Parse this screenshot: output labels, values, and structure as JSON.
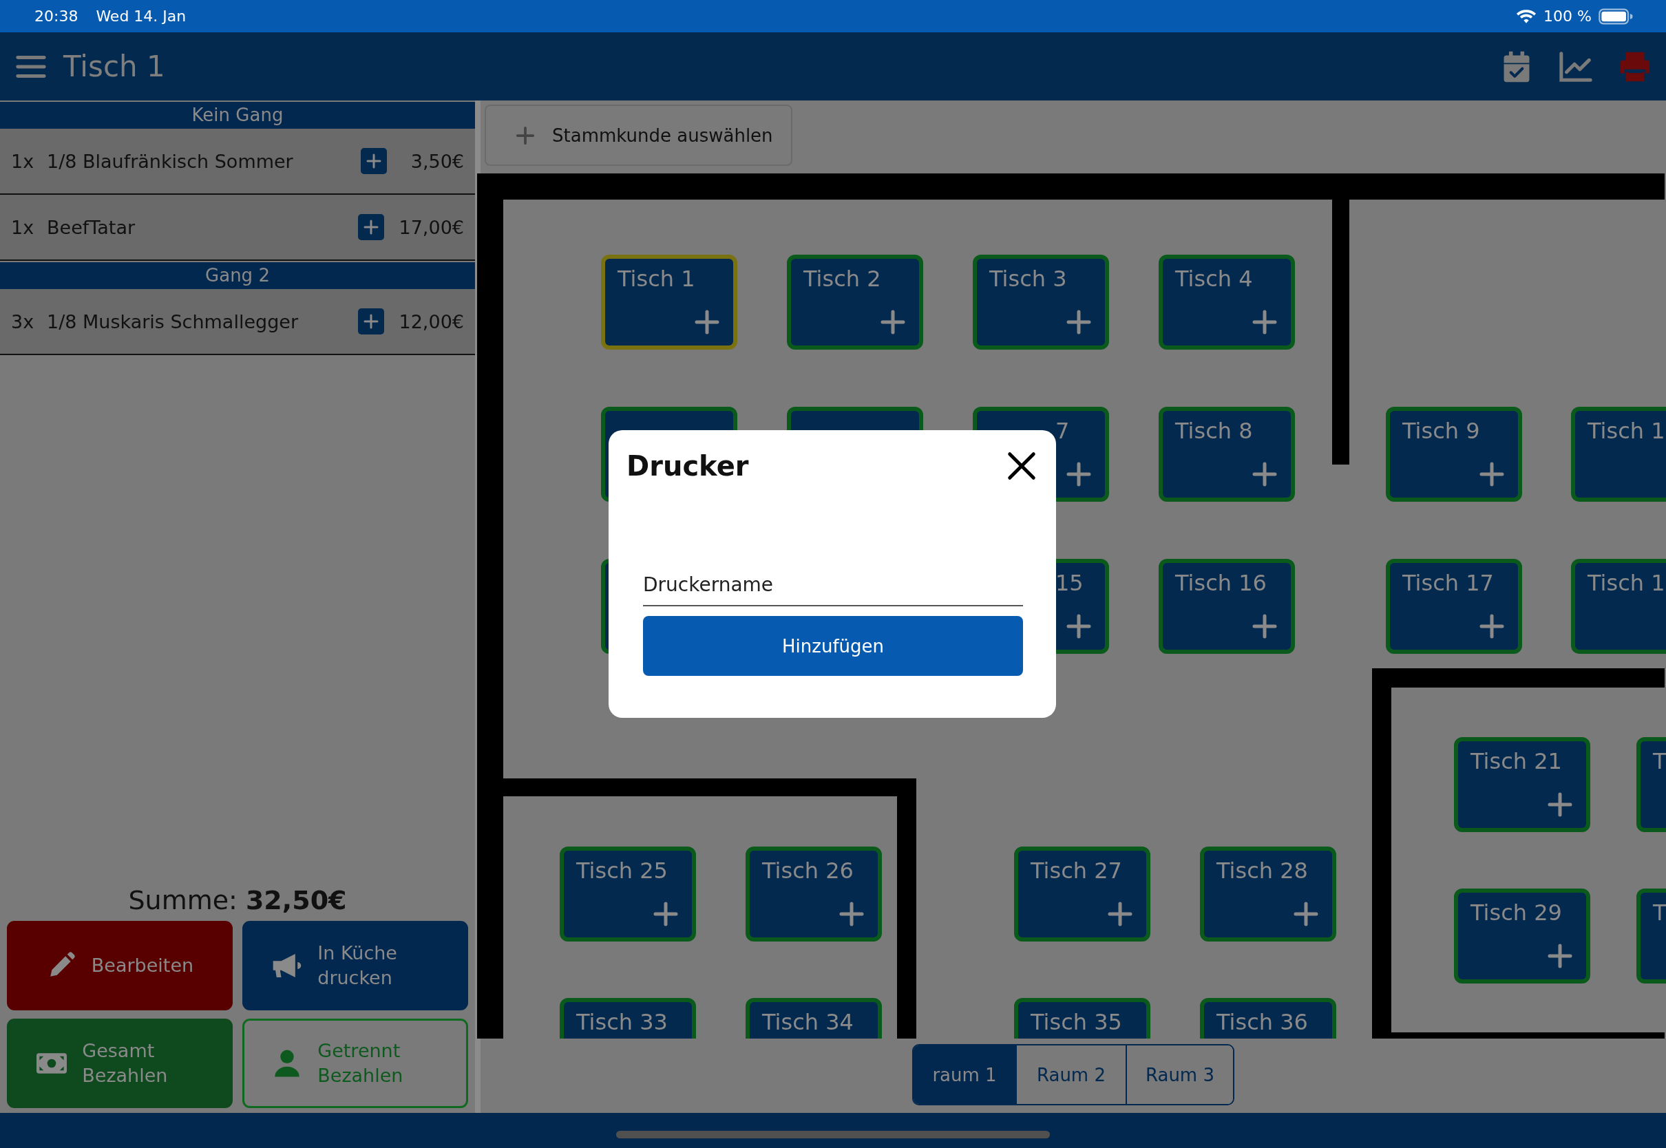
{
  "status_bar": {
    "time": "20:38",
    "date": "Wed 14. Jan",
    "battery": "100 %"
  },
  "header": {
    "title": "Tisch 1"
  },
  "order": {
    "courses": [
      {
        "name": "Kein Gang",
        "items": [
          {
            "qty": "1x",
            "name": "1/8 Blaufränkisch Sommer",
            "price": "3,50€"
          },
          {
            "qty": "1x",
            "name": "BeefTatar",
            "price": "17,00€"
          }
        ]
      },
      {
        "name": "Gang 2",
        "items": [
          {
            "qty": "3x",
            "name": "1/8 Muskaris Schmallegger",
            "price": "12,00€"
          }
        ]
      }
    ],
    "total_label": "Summe:",
    "total": "32,50€"
  },
  "action_rows": [
    {
      "buttons": [
        {
          "kind": "edit",
          "label": "Bearbeiten"
        },
        {
          "kind": "kitchen",
          "label": "In Küche drucken"
        }
      ]
    },
    {
      "buttons": [
        {
          "kind": "pay_all",
          "label": "Gesamt Bezahlen"
        },
        {
          "kind": "pay_split",
          "label": "Getrennt Bezahlen"
        }
      ]
    }
  ],
  "customer_button": {
    "label": "Stammkunde auswählen"
  },
  "tables": [
    {
      "label": "Tisch 1",
      "selected": true
    },
    {
      "label": "Tisch 2",
      "selected": false
    },
    {
      "label": "Tisch 3",
      "selected": false
    },
    {
      "label": "Tisch 4",
      "selected": false
    },
    {
      "show_plus": false,
      "selected": false
    },
    {
      "show_plus": false,
      "selected": false
    },
    {
      "kind": "covered",
      "label": "7",
      "selected": false
    },
    {
      "label": "Tisch 8",
      "selected": false
    },
    {
      "label": "Tisch 9",
      "selected": false
    },
    {
      "label": "Tisch 1",
      "show_plus": false,
      "selected": false
    },
    {
      "show_plus": false,
      "selected": false
    },
    {
      "kind": "covered",
      "label": "15",
      "selected": false
    },
    {
      "label": "Tisch 16",
      "selected": false
    },
    {
      "label": "Tisch 17",
      "selected": false
    },
    {
      "label": "Tisch 1",
      "show_plus": false,
      "selected": false
    },
    {
      "label": "Tisch 21",
      "selected": false
    },
    {
      "label": "T",
      "show_plus": false,
      "selected": false
    },
    {
      "label": "Tisch 25",
      "selected": false
    },
    {
      "label": "Tisch 26",
      "selected": false
    },
    {
      "label": "Tisch 27",
      "selected": false
    },
    {
      "label": "Tisch 28",
      "selected": false
    },
    {
      "label": "Tisch 29",
      "selected": false
    },
    {
      "label": "T",
      "show_plus": false,
      "selected": false
    },
    {
      "label": "Tisch 33",
      "selected": false
    },
    {
      "label": "Tisch 34",
      "selected": false
    },
    {
      "label": "Tisch 35",
      "selected": false
    },
    {
      "label": "Tisch 36",
      "selected": false
    }
  ],
  "rooms": [
    {
      "label": "raum 1",
      "selected": true
    },
    {
      "label": "Raum 2",
      "selected": false
    },
    {
      "label": "Raum 3",
      "selected": false
    }
  ],
  "dialog": {
    "title": "Drucker",
    "field": {
      "placeholder": "Druckername"
    },
    "button": "Hinzufügen"
  }
}
